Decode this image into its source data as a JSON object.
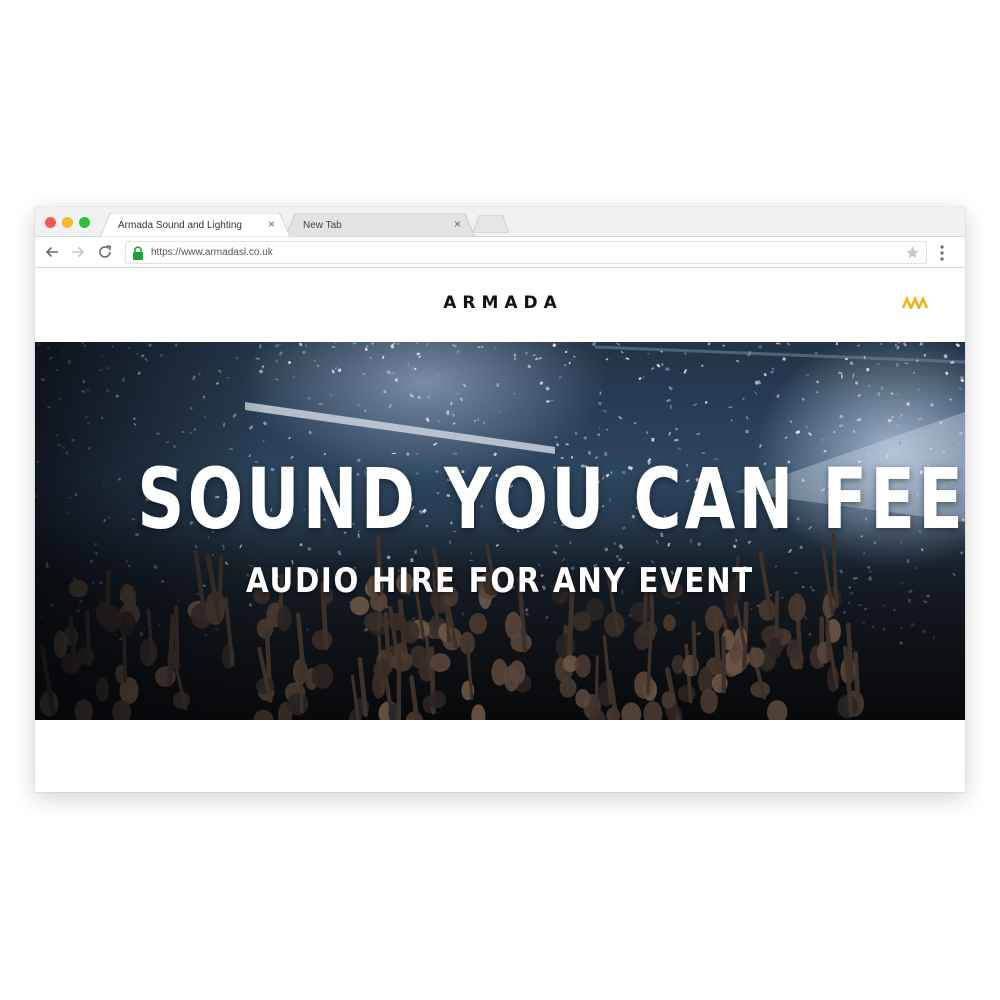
{
  "browser": {
    "tabs": [
      {
        "label": "Armada Sound and Lighting",
        "active": true
      },
      {
        "label": "New Tab",
        "active": false
      }
    ],
    "tab_close_glyph": "×",
    "url": "https://www.armadasl.co.uk",
    "icons": {
      "back": "arrow-left-icon",
      "forward": "arrow-right-icon",
      "reload": "reload-icon",
      "lock": "lock-icon",
      "bookmark": "star-icon",
      "menu": "kebab-menu-icon"
    },
    "colors": {
      "lock": "#1aa33a",
      "traffic_close": "#f25b50",
      "traffic_min": "#f6b82c",
      "traffic_max": "#2dbe3a"
    }
  },
  "site": {
    "logo": "ARMADA",
    "menu_icon": "zigzag-menu-icon",
    "accent": "#f2b418",
    "hero": {
      "title": "SOUND YOU CAN FEEL",
      "subtitle": "AUDIO HIRE FOR ANY EVENT"
    }
  }
}
